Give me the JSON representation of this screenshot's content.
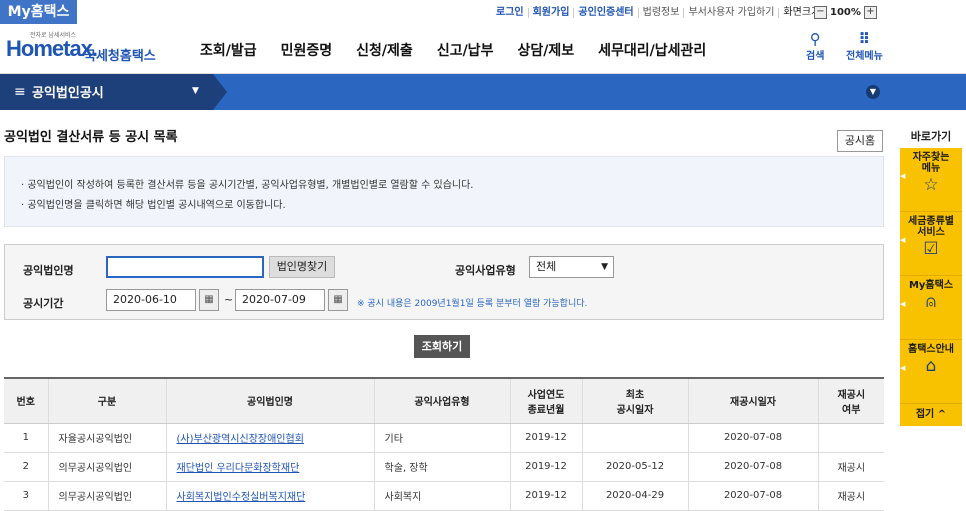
{
  "topbar": {
    "my_tab": "My홈택스",
    "links": [
      {
        "label": "로그인",
        "style": "blue"
      },
      {
        "label": "회원가입",
        "style": "blue"
      },
      {
        "label": "공인인증센터",
        "style": "blue"
      },
      {
        "label": "법령정보",
        "style": "gray"
      },
      {
        "label": "부서사용자 가입하기",
        "style": "gray"
      },
      {
        "label": "화면크기",
        "style": "last"
      }
    ],
    "zoom": {
      "minus": "−",
      "value": "100%",
      "plus": "+"
    }
  },
  "header": {
    "logo_tiny": "전자로 납세서비스",
    "logo_main": "Hometax.",
    "logo_sub": "국세청홈택스",
    "gnb": [
      "조회/발급",
      "민원증명",
      "신청/제출",
      "신고/납부",
      "상담/제보",
      "세무대리/납세관리"
    ],
    "search_label": "검색",
    "allmenu_label": "전체메뉴"
  },
  "menubar": {
    "title": "공익법인공시"
  },
  "page": {
    "title": "공익법인 결산서류 등 공시 목록",
    "home_button": "공시홈",
    "notices": [
      "· 공익법인이 작성하여 등록한 결산서류 등을 공시기간별, 공익사업유형별, 개별법인별로 열람할 수 있습니다.",
      "· 공익법인명을 클릭하면 해당 법인별 공시내역으로 이동합니다."
    ]
  },
  "form": {
    "corp_name_label": "공익법인명",
    "corp_name_value": "",
    "find_button": "법인명찾기",
    "biz_type_label": "공익사업유형",
    "biz_type_selected": "전체",
    "period_label": "공시기간",
    "date_from": "2020-06-10",
    "date_to": "2020-07-09",
    "tilde": "~",
    "note": "※ 공시 내용은 2009년1월1일 등록 분부터 열람 가능합니다.",
    "search_button": "조회하기"
  },
  "table": {
    "headers": [
      "번호",
      "구분",
      "공익법인명",
      "공익사업유형",
      "사업연도\n종료년월",
      "최초\n공시일자",
      "재공시일자",
      "재공시\n여부"
    ],
    "rows": [
      [
        "1",
        "자율공시공익법인",
        "(사)부산광역시신장장애인협회",
        "기타",
        "2019-12",
        "",
        "2020-07-08",
        ""
      ],
      [
        "2",
        "의무공시공익법인",
        "재단법인 우리다문화장학재단",
        "학술, 장학",
        "2019-12",
        "2020-05-12",
        "2020-07-08",
        "재공시"
      ],
      [
        "3",
        "의무공시공익법인",
        "사회복지법인수정실버복지재단",
        "사회복지",
        "2019-12",
        "2020-04-29",
        "2020-07-08",
        "재공시"
      ]
    ]
  },
  "quick": {
    "title": "바로가기",
    "items": [
      {
        "label": "자주찾는\n메뉴",
        "icon": "star-icon"
      },
      {
        "label": "세금종류별\n서비스",
        "icon": "checkbox-icon"
      },
      {
        "label": "My홈택스",
        "icon": "person-icon"
      },
      {
        "label": "홈택스안내",
        "icon": "house-icon"
      }
    ],
    "fold": "접기 ^"
  }
}
